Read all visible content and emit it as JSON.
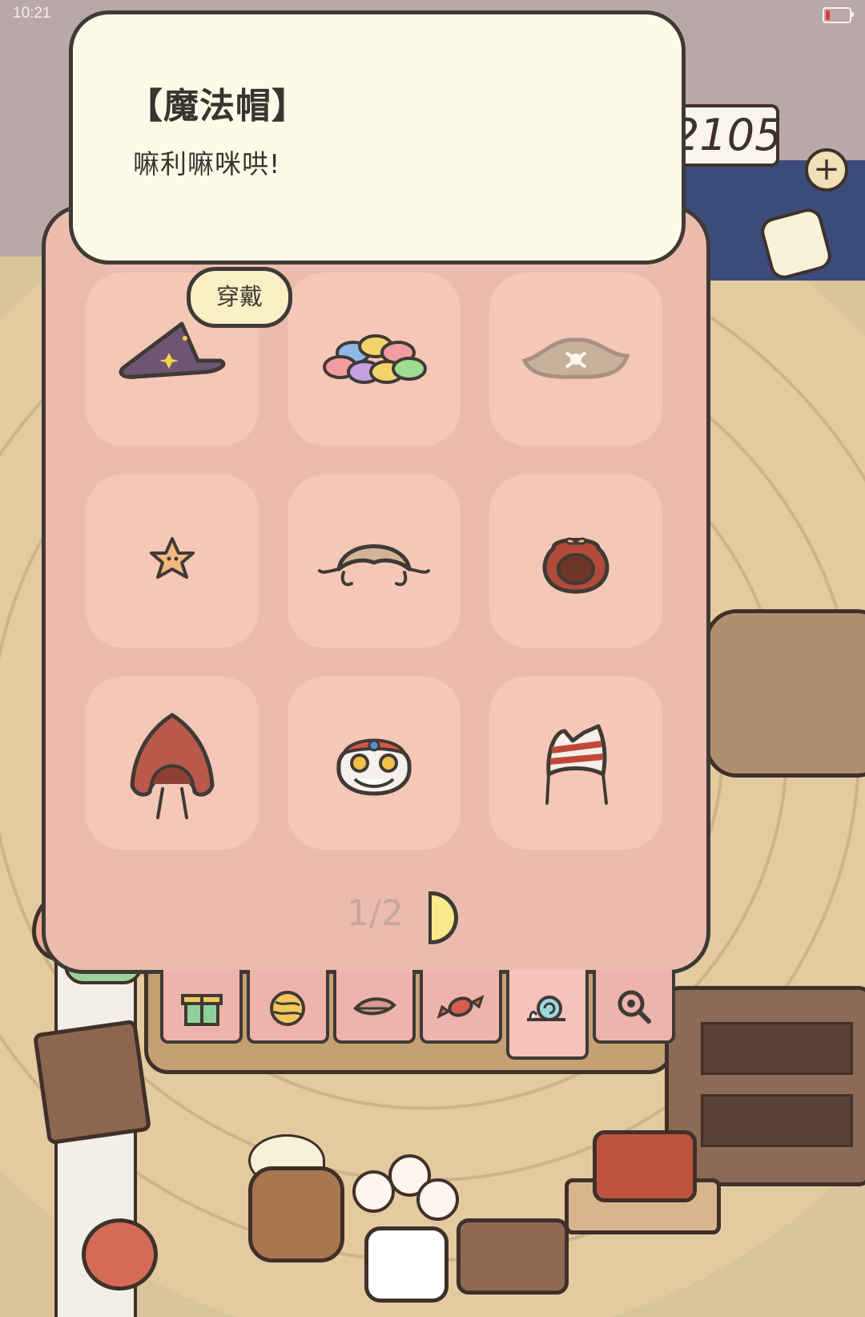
{
  "status_bar": {
    "time": "10:21"
  },
  "hud": {
    "score": "2105",
    "add_symbol": "+"
  },
  "tooltip": {
    "title": "【魔法帽】",
    "description": "嘛利嘛咪哄!"
  },
  "wear_button": {
    "label": "穿戴"
  },
  "items": [
    {
      "name": "magic-hat-icon",
      "selected": true
    },
    {
      "name": "colorful-macarons-icon"
    },
    {
      "name": "pirate-hat-icon"
    },
    {
      "name": "starfish-icon"
    },
    {
      "name": "aviator-cap-icon"
    },
    {
      "name": "lucky-bag-icon"
    },
    {
      "name": "red-hood-icon"
    },
    {
      "name": "lion-dance-head-icon"
    },
    {
      "name": "striped-cat-beanie-icon"
    }
  ],
  "pager": {
    "text": "1/2"
  },
  "tabs": [
    {
      "name": "gift-tab-icon"
    },
    {
      "name": "yarn-ball-tab-icon"
    },
    {
      "name": "leaf-tab-icon"
    },
    {
      "name": "candy-tab-icon"
    },
    {
      "name": "snail-tab-icon",
      "active": true
    },
    {
      "name": "magnifier-tab-icon"
    }
  ],
  "colors": {
    "panel": "#ebbcae",
    "card": "#f5c7b7",
    "tooltip": "#fdfbe8",
    "outline": "#3f3a36",
    "accent_yellow": "#fbe98a"
  }
}
